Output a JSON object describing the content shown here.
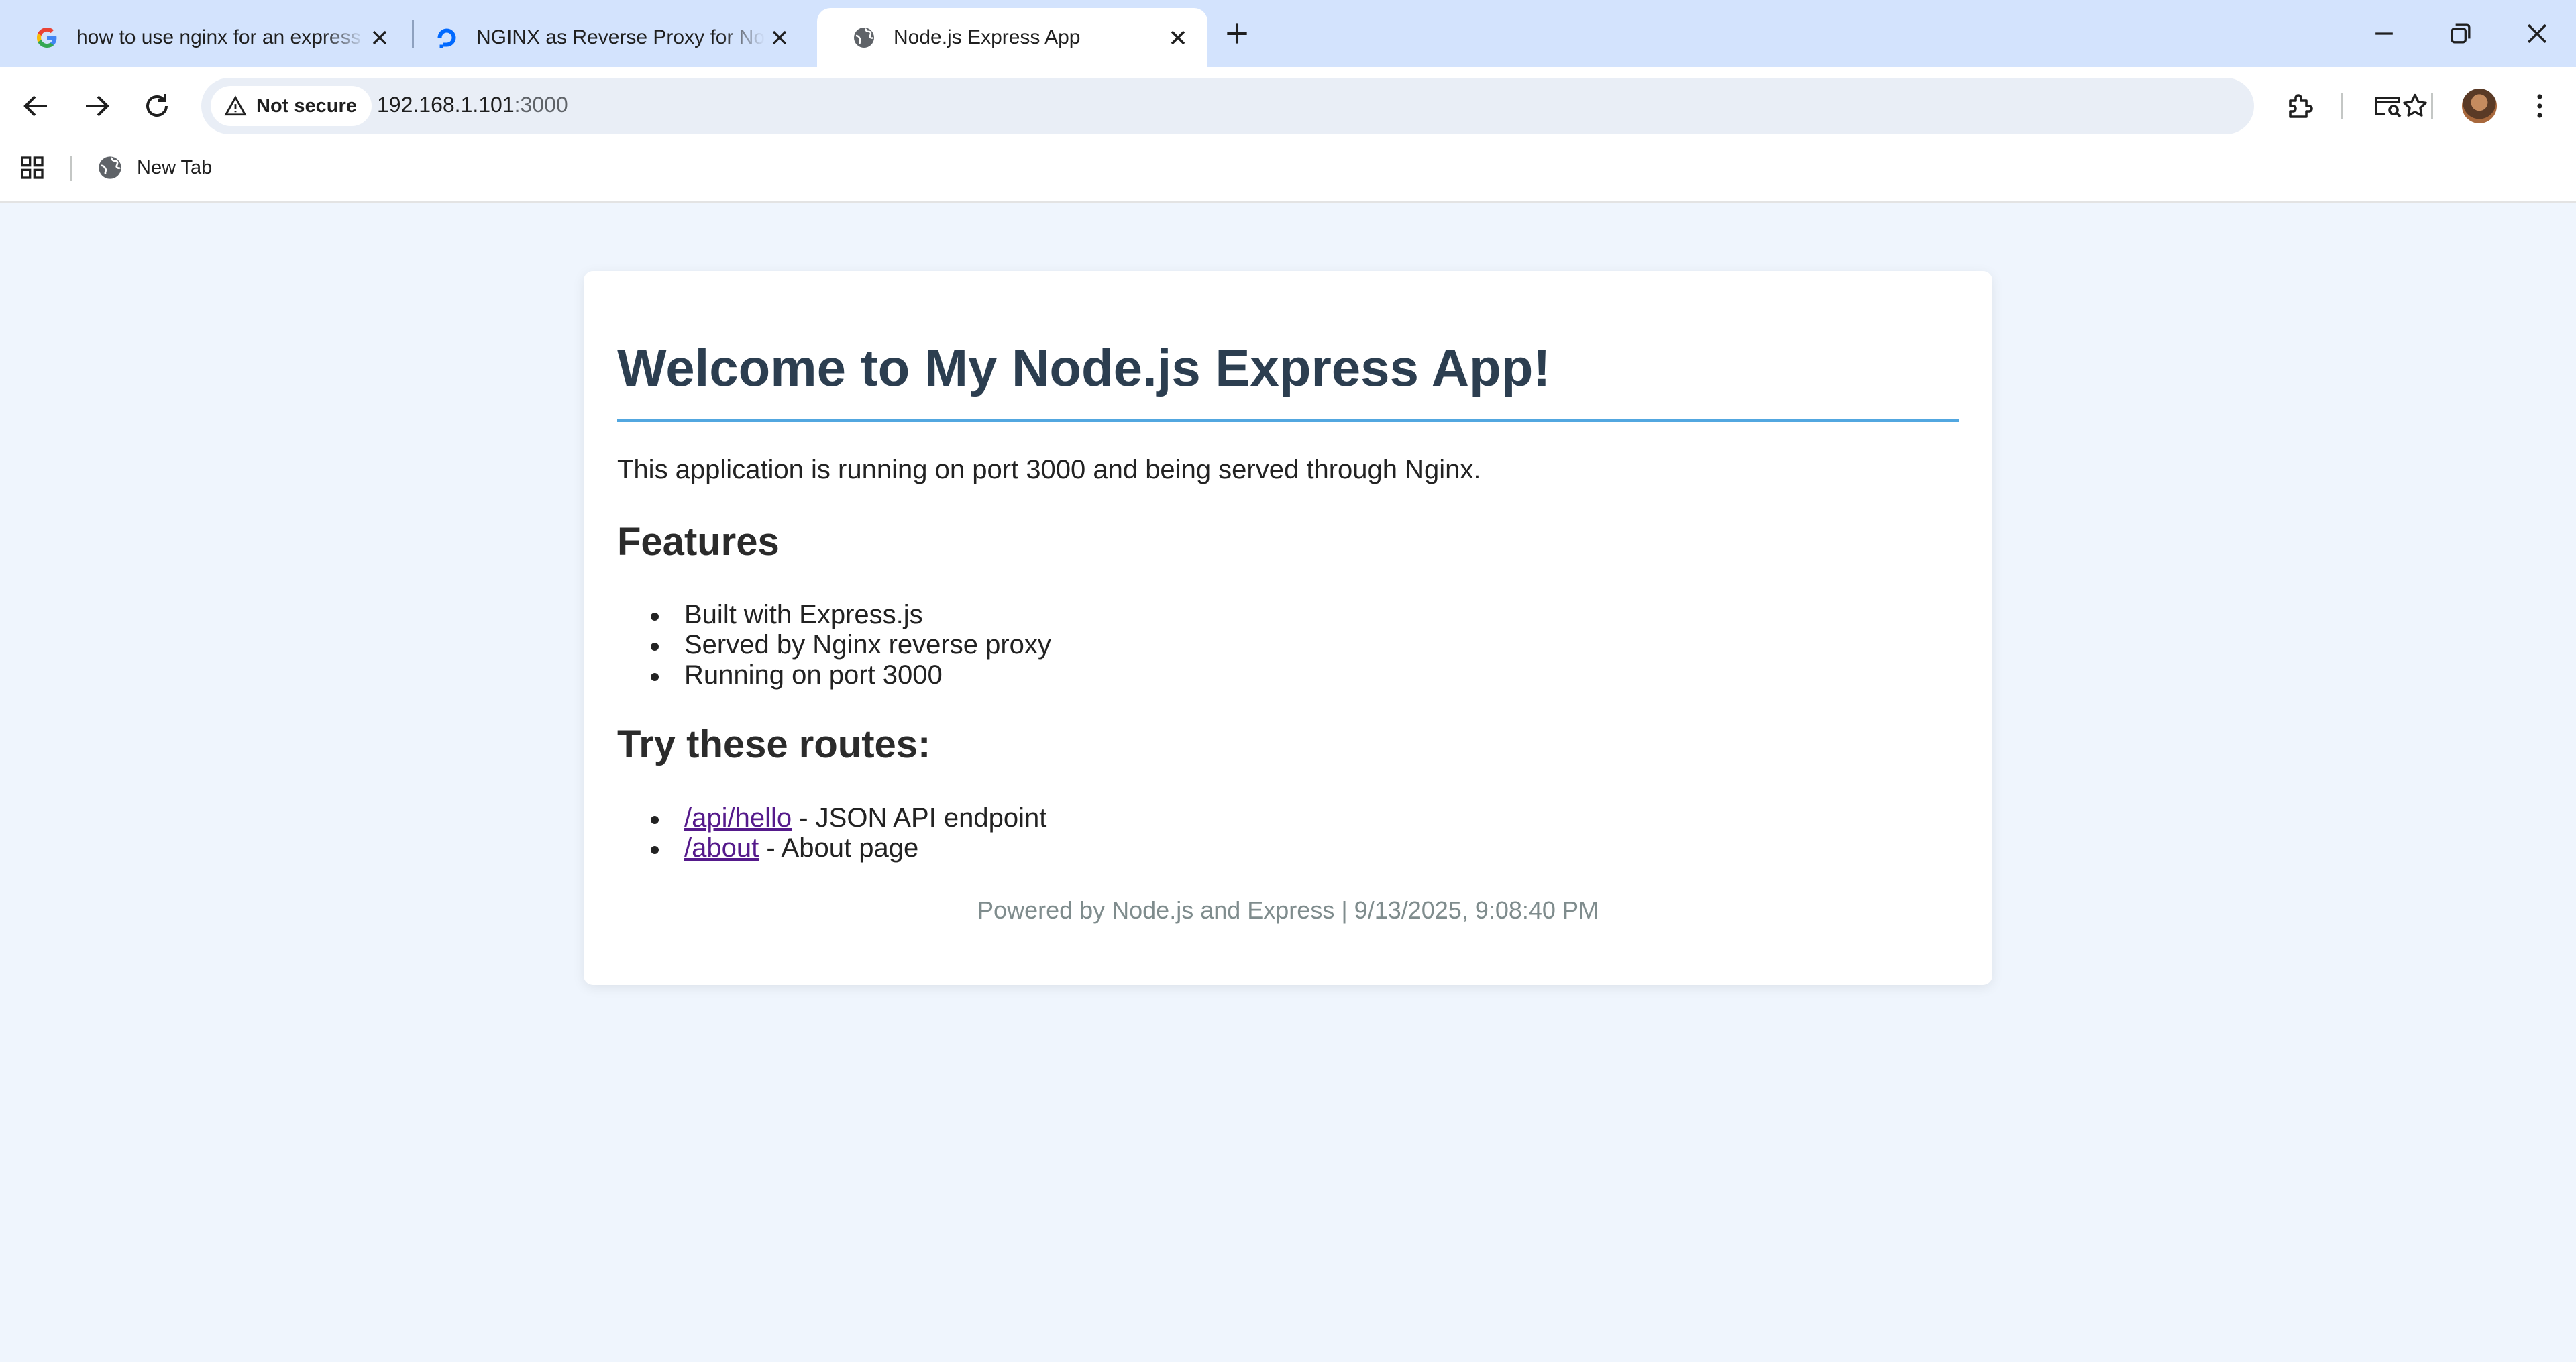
{
  "browser": {
    "tabs": [
      {
        "title": "how to use nginx for an express app",
        "favicon": "google-icon",
        "active": false
      },
      {
        "title": "NGINX as Reverse Proxy for Node.js",
        "favicon": "digitalocean-icon",
        "active": false
      },
      {
        "title": "Node.js Express App",
        "favicon": "globe-icon",
        "active": true
      }
    ],
    "security_label": "Not secure",
    "url_host": "192.168.1.101",
    "url_port": ":3000",
    "bookmarks": [
      {
        "label": "New Tab",
        "icon": "globe-icon"
      }
    ]
  },
  "page": {
    "title": "Welcome to My Node.js Express App!",
    "intro": "This application is running on port 3000 and being served through Nginx.",
    "features_heading": "Features",
    "features": [
      "Built with Express.js",
      "Served by Nginx reverse proxy",
      "Running on port 3000"
    ],
    "routes_heading": "Try these routes:",
    "routes": [
      {
        "link": "/api/hello",
        "desc": " - JSON API endpoint"
      },
      {
        "link": "/about",
        "desc": " - About page"
      }
    ],
    "footer": "Powered by Node.js and Express | 9/13/2025, 9:08:40 PM"
  },
  "colors": {
    "heading": "#2c3e50",
    "rule": "#3498db",
    "link_visited": "#551a8b",
    "footer": "#7f8c8d",
    "tabstrip": "#d3e3fd"
  }
}
